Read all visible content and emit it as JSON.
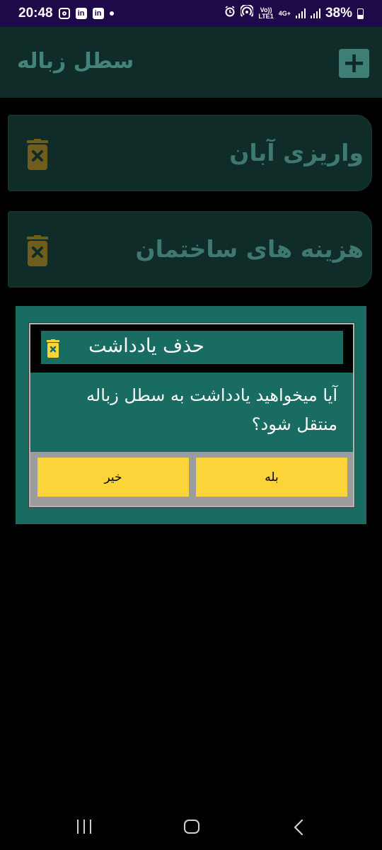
{
  "status_bar": {
    "time": "20:48",
    "battery": "38%",
    "volte": "Vo))",
    "lte": "LTE1",
    "network": "4G+"
  },
  "app_bar": {
    "title": "سطل زباله",
    "add_label": "+"
  },
  "notes": [
    {
      "title": "واریزی آبان"
    },
    {
      "title": "هزینه های ساختمان"
    }
  ],
  "dialog": {
    "title": "حذف یادداشت",
    "message": "آیا میخواهید یادداشت به سطل زباله منتقل شود؟",
    "yes_label": "بله",
    "no_label": "خیر"
  },
  "colors": {
    "status_bar": "#1e0a49",
    "app_bar": "#0f2c29",
    "accent_text": "#3e7870",
    "trash_icon": "#6e5d1d",
    "dialog": "#186c62",
    "button": "#fbd43a"
  },
  "icons": {
    "status_left": [
      "instagram-icon",
      "linkedin-icon",
      "linkedin-icon",
      "dot-icon"
    ],
    "status_right": [
      "alarm-icon",
      "hotspot-icon",
      "signal-icon",
      "signal-icon",
      "battery-icon"
    ],
    "note": "trash-x-icon",
    "nav": [
      "recent-apps-icon",
      "home-icon",
      "back-icon"
    ]
  }
}
